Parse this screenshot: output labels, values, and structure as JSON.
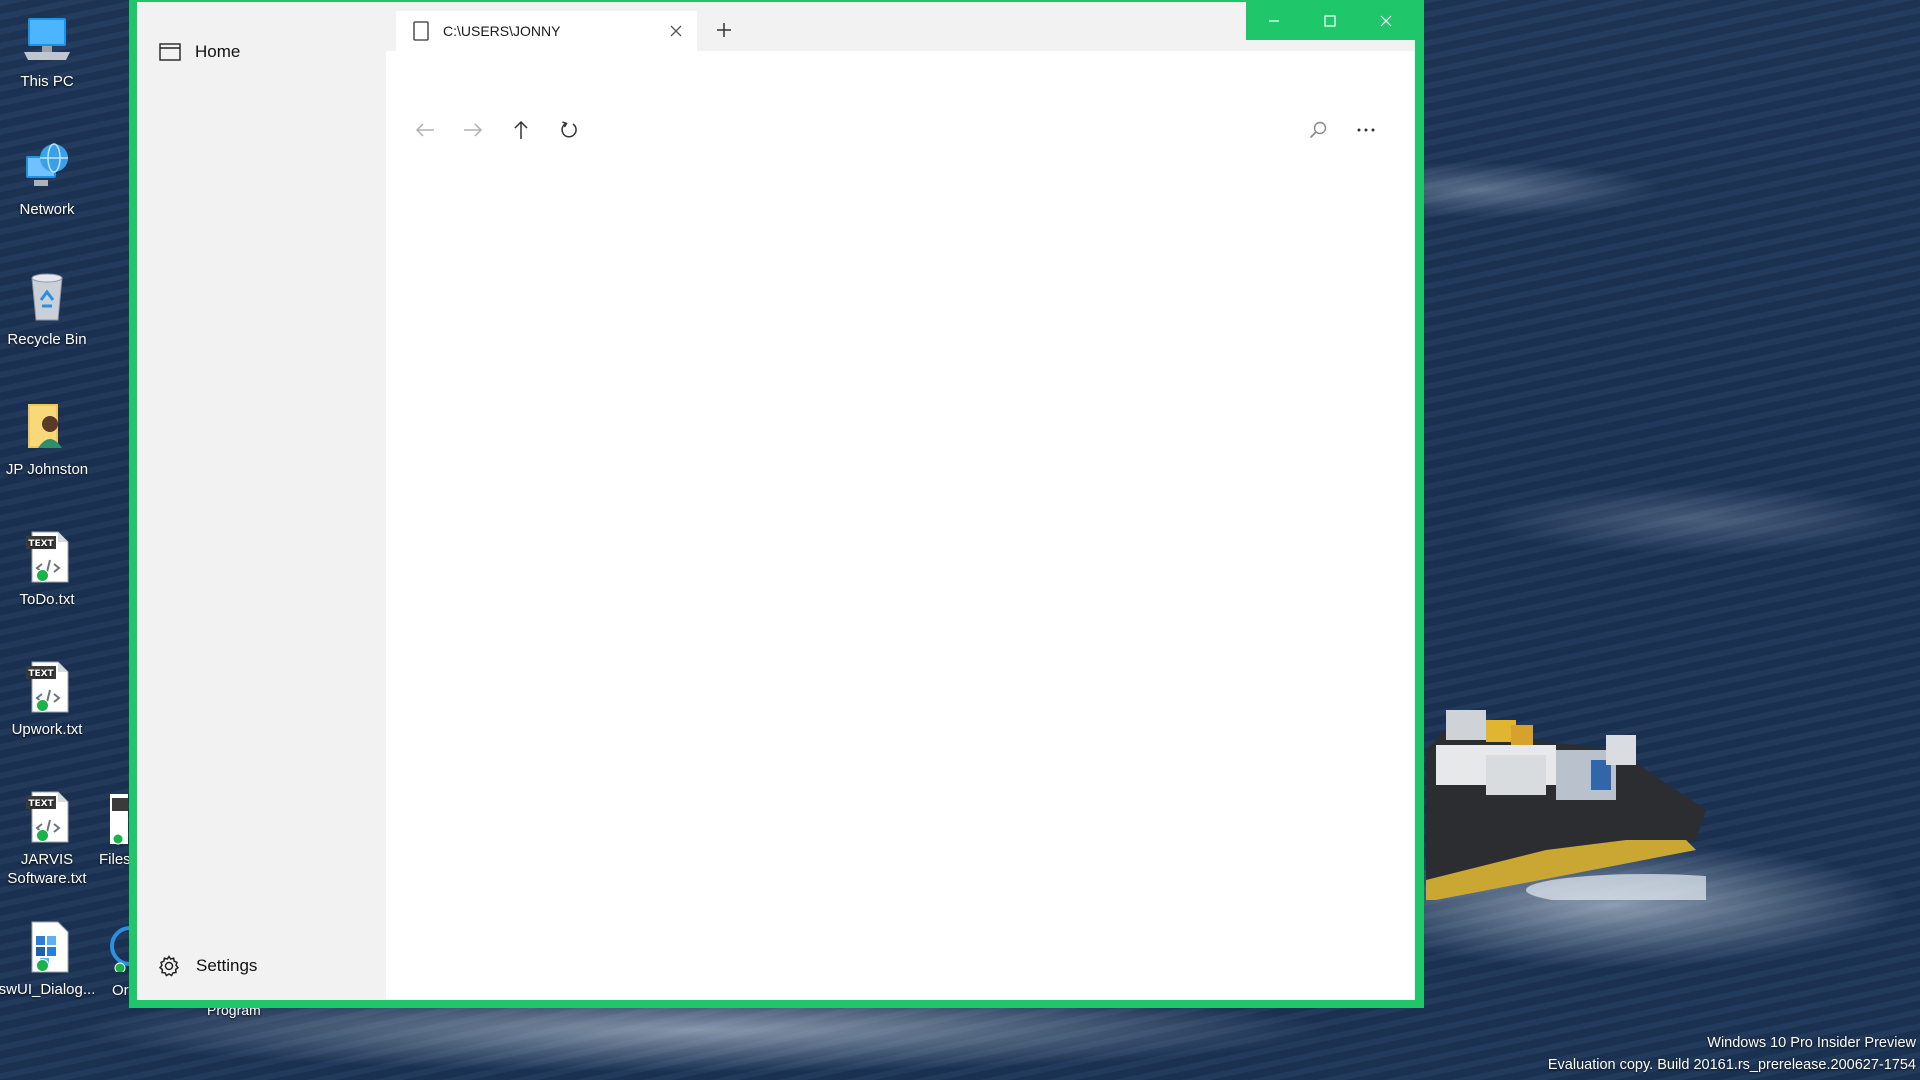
{
  "desktop": {
    "icons": [
      {
        "label": "This PC",
        "icon": "computer-icon"
      },
      {
        "label": "Network",
        "icon": "network-globe-icon"
      },
      {
        "label": "Recycle Bin",
        "icon": "recycle-bin-icon"
      },
      {
        "label": "JP Johnston",
        "icon": "user-folder-icon"
      },
      {
        "label": "ToDo.txt",
        "icon": "text-file-icon"
      },
      {
        "label": "Upwork.txt",
        "icon": "text-file-icon"
      },
      {
        "label": "JARVIS Software.txt",
        "icon": "text-file-icon"
      },
      {
        "label": "swUI_Dialog...",
        "icon": "app-file-icon"
      }
    ],
    "partial_icons": [
      {
        "label": "Files"
      },
      {
        "label": "Or"
      }
    ],
    "behind_window_label": "Program",
    "file_badge_text": "TEXT",
    "watermark": {
      "line1": "Windows 10 Pro Insider Preview",
      "line2": "Evaluation copy. Build 20161.rs_prerelease.200627-1754"
    }
  },
  "window": {
    "accent_color": "#20c66a",
    "sidebar": {
      "home_label": "Home",
      "settings_label": "Settings"
    },
    "tab": {
      "title": "C:\\USERS\\JONNY"
    },
    "captions": [
      "minimize",
      "maximize",
      "close"
    ],
    "toolbar": [
      "back",
      "forward",
      "up",
      "refresh",
      "search",
      "more"
    ]
  }
}
